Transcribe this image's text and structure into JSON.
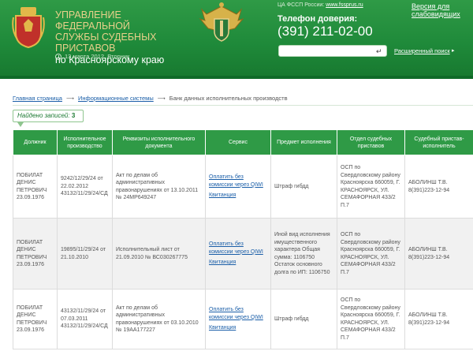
{
  "header": {
    "org_line1": "УПРАВЛЕНИЕ ФЕДЕРАЛЬНОЙ",
    "org_line2": "СЛУЖБЫ СУДЕБНЫХ ПРИСТАВОВ",
    "org_line3": "по Красноярскому краю",
    "date": "13 марта 2012, Вторник",
    "fssp_label": "ЦА ФССП России:",
    "fssp_link": "www.fssprus.ru",
    "phone_label": "Телефон доверия:",
    "phone_number": "(391) 211-02-00",
    "vi_version": "Версия для слабовидящих",
    "search_placeholder": "",
    "advanced_search": "Расширенный поиск"
  },
  "breadcrumb": {
    "home": "Главная страница",
    "info_systems": "Информационные системы",
    "current": "Банк данных исполнительных производств"
  },
  "found": {
    "label": "Найдено записей:",
    "count": "3"
  },
  "table": {
    "headers": [
      "Должник",
      "Исполнительное производство",
      "Реквизиты исполнительного документа",
      "Сервис",
      "Предмет исполнения",
      "Отдел судебных приставов",
      "Судебный пристав-исполнитель"
    ],
    "rows": [
      {
        "debtor": "ПОБИЛАТ ДЕНИС ПЕТРОВИЧ 23.09.1976",
        "proceeding": "9242/12/29/24 от 22.02.2012 43132/11/29/24/СД",
        "document": "Акт по делам об административных правонарушениях от 13.10.2011 № 24МР649247",
        "service_pay": "Оплатить без комиссии через QIWI",
        "service_receipt": "Квитанция",
        "subject": "Штраф гибдд",
        "department": "ОСП по Свердловскому району Красноярска 660059, Г. КРАСНОЯРСК, УЛ. СЕМАФОРНАЯ 433/2 П.7",
        "bailiff": "АБОЛИНШ Т.В. 8(391)223-12-94"
      },
      {
        "debtor": "ПОБИЛАТ ДЕНИС ПЕТРОВИЧ 23.09.1976",
        "proceeding": "19895/11/29/24 от 21.10.2010",
        "document": "Исполнительный лист от 21.09.2010 № ВС030267775",
        "service_pay": "Оплатить без комиссии через QIWI",
        "service_receipt": "Квитанция",
        "subject": "Иной вид исполнения имущественного характера Общая сумма: 1106750 Остаток основного долга по ИП: 1106750",
        "department": "ОСП по Свердловскому району Красноярска 660059, Г. КРАСНОЯРСК, УЛ. СЕМАФОРНАЯ 433/2 П.7",
        "bailiff": "АБОЛИНШ Т.В. 8(391)223-12-94"
      },
      {
        "debtor": "ПОБИЛАТ ДЕНИС ПЕТРОВИЧ 23.09.1976",
        "proceeding": "43132/11/29/24 от 07.03.2011 43132/11/29/24/СД",
        "document": "Акт по делам об административных правонарушениях от 03.10.2010 № 19АА177227",
        "service_pay": "Оплатить без комиссии через QIWI",
        "service_receipt": "Квитанция",
        "subject": "Штраф гибдд",
        "department": "ОСП по Свердловскому району Красноярска 660059, Г. КРАСНОЯРСК, УЛ. СЕМАФОРНАЯ 433/2 П.7",
        "bailiff": "АБОЛИНШ Т.В. 8(391)223-12-94"
      }
    ]
  },
  "colors": {
    "header_green": "#2f9a46",
    "title_gold": "#e8d08a",
    "link_blue": "#1a5ea8"
  },
  "icons": [
    "krasnoyarsk-emblem-icon",
    "clock-icon",
    "fssp-emblem-icon",
    "enter-icon",
    "breadcrumb-arrow-icon"
  ]
}
